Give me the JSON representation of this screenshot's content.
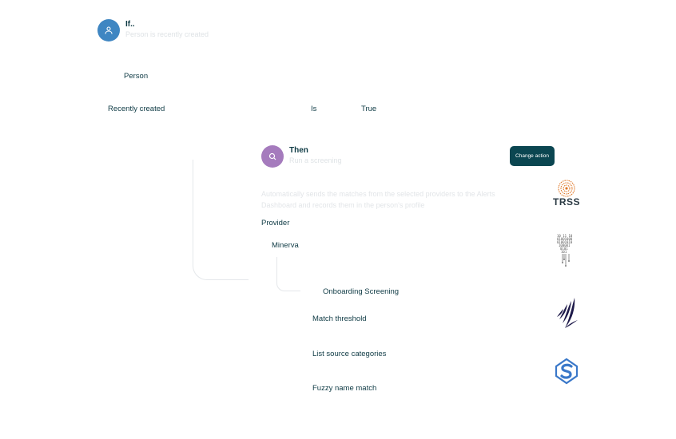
{
  "trigger": {
    "title": "If..",
    "subtitle": "Person is recently created",
    "entity": "Person",
    "condition": {
      "field": "Recently created",
      "operator": "Is",
      "value": "True"
    }
  },
  "action": {
    "title": "Then",
    "subtitle": "Run a screening",
    "change_label": "Change action",
    "description_line1": "Automatically sends the matches from the selected providers to the Alerts",
    "description_line2": "Dashboard and records them in the person's profile",
    "provider_label": "Provider",
    "provider_value": "Minerva",
    "screening_name": "Onboarding Screening",
    "settings": [
      "Match threshold",
      "List source categories",
      "Fuzzy name match"
    ]
  },
  "logos": {
    "trss_text": "TRSS"
  },
  "colors": {
    "if_avatar": "#3f86c2",
    "then_avatar": "#a57bbd",
    "button": "#0b4651",
    "text": "#0f3b45",
    "trss_orange": "#e07a2c",
    "wing": "#1e1a4a",
    "s_logo": "#3a78c9"
  },
  "icons": [
    "person-icon",
    "search-icon",
    "trss-logo",
    "binary-logo",
    "wing-logo",
    "s-logo"
  ]
}
